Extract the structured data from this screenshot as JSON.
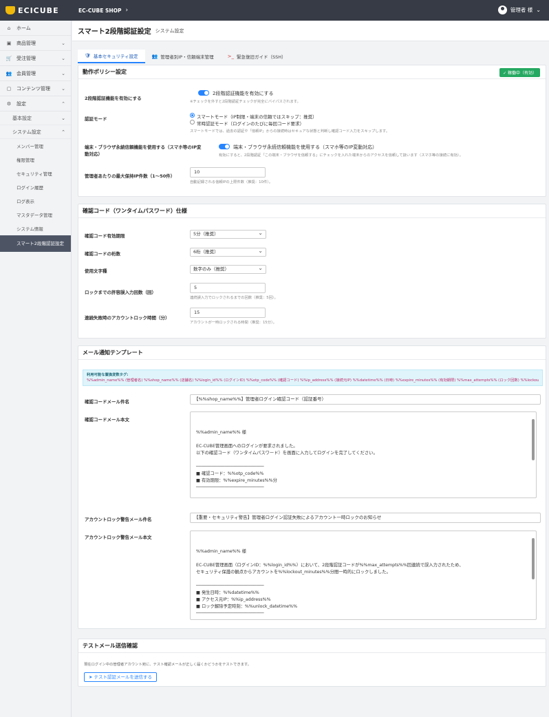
{
  "header": {
    "logo_text": "ECICUBE",
    "shop_name": "EC-CUBE SHOP",
    "shop_chevron": "›",
    "user_name": "管理者 様",
    "user_chevron": "⌄"
  },
  "sidebar": {
    "items": [
      {
        "icon": "home-icon",
        "glyph": "⌂",
        "label": "ホーム"
      },
      {
        "icon": "box-icon",
        "glyph": "▣",
        "label": "商品管理",
        "chevron": "⌄"
      },
      {
        "icon": "cart-icon",
        "glyph": "🛒",
        "label": "受注管理",
        "chevron": "⌄"
      },
      {
        "icon": "users-icon",
        "glyph": "👥",
        "label": "会員管理",
        "chevron": "⌄"
      },
      {
        "icon": "file-icon",
        "glyph": "▢",
        "label": "コンテンツ管理",
        "chevron": "⌄"
      },
      {
        "icon": "gear-icon",
        "glyph": "⚙",
        "label": "設定",
        "chevron": "⌃"
      }
    ],
    "sub_items": [
      {
        "label": "基本設定",
        "chevron": "⌄"
      },
      {
        "label": "システム設定",
        "chevron": "⌃"
      }
    ],
    "subsub_items": [
      "メンバー管理",
      "権限管理",
      "セキュリティ管理",
      "ログイン履歴",
      "ログ表示",
      "マスタデータ管理",
      "システム情報",
      "スマート2段階認証設定"
    ]
  },
  "main": {
    "title": "スマート2段階認証設定",
    "subtitle": "システム設定",
    "tabs": [
      {
        "icon": "shield-icon",
        "glyph": "🛡",
        "label": "基本セキュリティ設定"
      },
      {
        "icon": "users-icon",
        "glyph": "👥",
        "label": "管理者別IP・信頼端末管理"
      },
      {
        "icon": "terminal-icon",
        "glyph": ">_",
        "label": "緊急復旧ガイド（SSH）"
      }
    ]
  },
  "policy": {
    "title": "動作ポリシー設定",
    "badge": "✓ 稼働中（有効）",
    "enable_label": "2段階認証機能を有効にする",
    "enable_text": "2段階認証機能を有効にする",
    "enable_hint": "※チェックを外すと2段階認証チェックが完全にバイパスされます。",
    "mode_label": "認証モード",
    "mode_opt1": "スマートモード（IP制限・端末の信頼ではスキップ：推奨）",
    "mode_opt2": "常時認証モード（ログインのたびに毎回コード要求）",
    "mode_hint": "スマートモードでは、過去の認証や「信頼IP」からの接続時はセキュアな状態と判断し確認コード入力をスキップします。",
    "trust_label": "端末・ブラウザ永続信頼機能を使用する（スマホ等のIP変動対応）",
    "trust_text": "端末・ブラウザ永続信頼機能を使用する（スマホ等のIP変動対応）",
    "trust_hint": "有効にすると、2段階認証「この端末・ブラウザを信頼する」にチェックを入れた端末からのアクセスを信頼して扱います（スマホ等の接続に有効）。",
    "maxip_label": "管理者あたりの最大保持IP件数（1〜50件）",
    "maxip_value": "10",
    "maxip_hint": "自動記録される信頼IPの上限件数（推奨：10件）。"
  },
  "otp": {
    "title": "確認コード（ワンタイムパスワード）仕様",
    "rows": [
      {
        "label": "確認コード有効期限",
        "value": "5分（推奨）"
      },
      {
        "label": "確認コードの桁数",
        "value": "6桁（推奨）"
      },
      {
        "label": "使用文字種",
        "value": "数字のみ（推奨）"
      }
    ],
    "attempts_label": "ロックまでの許容誤入力回数（回）",
    "attempts_value": "5",
    "attempts_hint": "連続誤入力でロックされるまでの回数（推奨：5回）。",
    "lock_label": "連続失敗時のアカウントロック時間（分）",
    "lock_value": "15",
    "lock_hint": "アカウントが一時ロックされる時間（推奨：15分）。"
  },
  "mail": {
    "title": "メール通知テンプレート",
    "vars_title": "利用可能な置換変数タグ:",
    "vars_line1": "%%admin_name%% (管理者名) %%shop_name%% (店舗名) %%login_id%% (ログインID) %%otp_code%% (確認コード) %%ip_address%% (接続元IP) %%datetime%% (日時) %%expire_minutes%% (有効期限) %%max_attempts%% (ロック回数) %%lockout_minutes%% (ロック時間) %%unlock_datetime%% (ロック解除予定時刻)",
    "subject1_label": "確認コードメール件名",
    "subject1_value": "【%%shop_name%%】管理者ログイン確認コード（認証番号）",
    "body1_label": "確認コードメール本文",
    "body1_value": "%%admin_name%% 様\n\nEC-CUBE管理画面へのログインが要求されました。\n以下の確認コード（ワンタイムパスワード）を画面に入力してログインを完了してください。\n\n──────────────────────────\n■ 確認コード：%%otp_code%%\n■ 有効期限：%%expire_minutes%%分\n──────────────────────────\n\n【アクセス情報】\n・日時：%%datetime%%\n・接続元IP：%%ip_address%%",
    "subject2_label": "アカウントロック警告メール件名",
    "subject2_value": "【重要・セキュリティ警告】管理者ログイン認証失敗によるアカウント一時ロックのお知らせ",
    "body2_label": "アカウントロック警告メール本文",
    "body2_value": "%%admin_name%% 様\n\nEC-CUBE管理画面（ログインID：%%login_id%%）において、2段階認証コードが%%max_attempts%%回連続で誤入力されたため、\nセキュリティ保護の観点からアカウントを%%lockout_minutes%%分間一時的にロックしました。\n\n──────────────────────────\n■ 発生日時：%%datetime%%\n■ アクセス元IP：%%ip_address%%\n■ ロック解除予定時刻：%%unlock_datetime%%\n──────────────────────────\n\n【緊急ロック解除方法】\n本メールにお心当たりがない場合は、不正アクセスの可能性があります。直ちにシステム管理者へご連絡ください。"
  },
  "test": {
    "title": "テストメール送信確認",
    "desc": "現在ログイン中の管理者アカウント宛に、テスト確認メールが正しく届くかどうかをテストできます。",
    "button": "テスト認証メールを送信する"
  }
}
